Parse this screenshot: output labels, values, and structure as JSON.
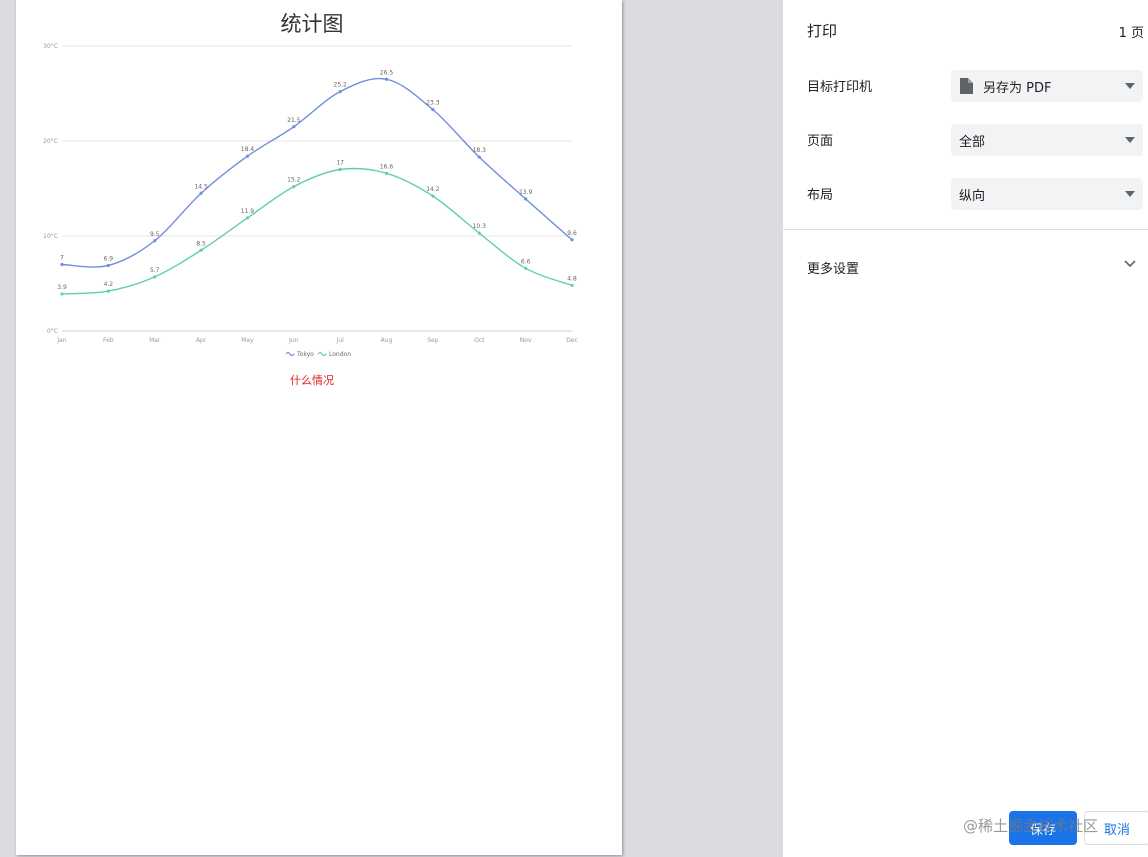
{
  "paper": {
    "chart_title": "统计图",
    "note": "什么情况"
  },
  "chart_data": {
    "type": "line",
    "title": "统计图",
    "categories": [
      "Jan",
      "Feb",
      "Mar",
      "Apr",
      "May",
      "Jun",
      "Jul",
      "Aug",
      "Sep",
      "Oct",
      "Nov",
      "Dec"
    ],
    "series": [
      {
        "name": "Tokyo",
        "color": "#6f8fdc",
        "values": [
          7.0,
          6.9,
          9.5,
          14.5,
          18.4,
          21.5,
          25.2,
          26.5,
          23.3,
          18.3,
          13.9,
          9.6
        ]
      },
      {
        "name": "London",
        "color": "#5fd39d",
        "values": [
          3.9,
          4.2,
          5.7,
          8.5,
          11.9,
          15.2,
          17.0,
          16.6,
          14.2,
          10.3,
          6.6,
          4.8
        ]
      }
    ],
    "y_ticks": [
      "0°C",
      "10°C",
      "20°C",
      "30°C"
    ],
    "ylim": [
      0,
      30
    ],
    "xlabel": "",
    "ylabel": "",
    "legend_position": "bottom-center",
    "grid": true,
    "data_labels": true,
    "smooth": true
  },
  "settings": {
    "title": "打印",
    "page_count": "1 页",
    "destination": {
      "label": "目标打印机",
      "value": "另存为 PDF"
    },
    "pages": {
      "label": "页面",
      "value": "全部"
    },
    "layout": {
      "label": "布局",
      "value": "纵向"
    },
    "more_settings": "更多设置",
    "save_button": "保存",
    "cancel_button": "取消"
  },
  "watermark": "@稀土掘金技术社区",
  "colors": {
    "accent": "#1a73e8",
    "preview_background": "#dadce0",
    "note_color": "#e02020"
  }
}
